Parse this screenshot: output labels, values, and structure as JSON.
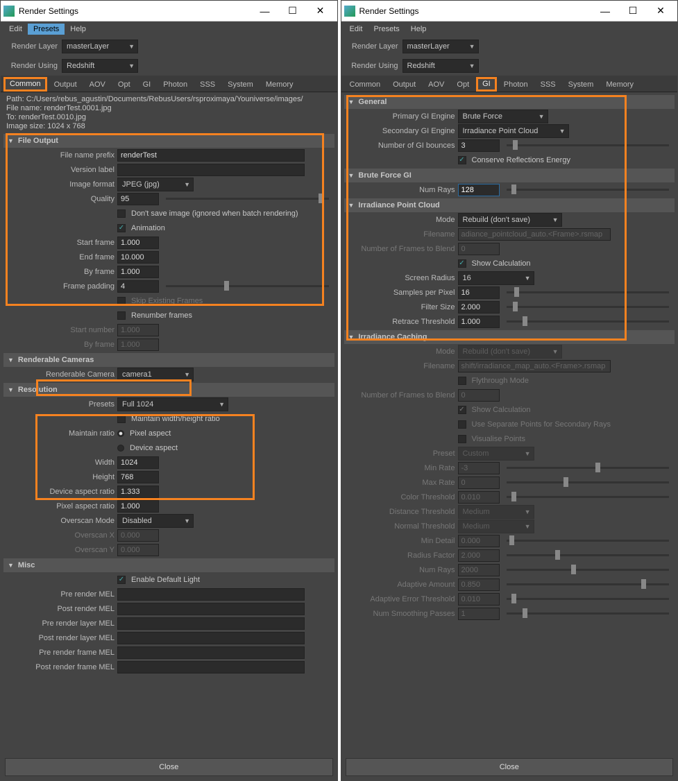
{
  "titlebar": {
    "title": "Render Settings"
  },
  "menubar": {
    "edit": "Edit",
    "presets": "Presets",
    "help": "Help"
  },
  "toprows": {
    "renderLayer": "Render Layer",
    "renderUsing": "Render Using",
    "masterLayer": "masterLayer",
    "redshift": "Redshift"
  },
  "tabs": [
    "Common",
    "Output",
    "AOV",
    "Opt",
    "GI",
    "Photon",
    "SSS",
    "System",
    "Memory"
  ],
  "path": {
    "l1": "Path: C:/Users/rebus_agustin/Documents/RebusUsers/rsproximaya/Youniverse/images/",
    "l2": "File name:  renderTest.0001.jpg",
    "l3": "To:              renderTest.0010.jpg",
    "l4": "Image size: 1024 x 768"
  },
  "s": {
    "fileOutput": "File Output",
    "renderableCameras": "Renderable Cameras",
    "resolution": "Resolution",
    "misc": "Misc",
    "general": "General",
    "bruteForce": "Brute Force GI",
    "ipc": "Irradiance Point Cloud",
    "icache": "Irradiance Caching"
  },
  "f": {
    "fnp": "File name prefix",
    "fnpv": "renderTest",
    "vl": "Version label",
    "imf": "Image format",
    "imfv": "JPEG (jpg)",
    "quality": "Quality",
    "qv": "95",
    "dsave": "Don't save image (ignored when batch rendering)",
    "anim": "Animation",
    "sf": "Start frame",
    "sfv": "1.000",
    "ef": "End frame",
    "efv": "10.000",
    "bf": "By frame",
    "bfv": "1.000",
    "fp": "Frame padding",
    "fpv": "4",
    "skip": "Skip Existing Frames",
    "renum": "Renumber frames",
    "sn": "Start number",
    "snv": "1.000",
    "bf2": "By frame",
    "bf2v": "1.000"
  },
  "cam": {
    "lbl": "Renderable Camera",
    "val": "camera1"
  },
  "res": {
    "presets": "Presets",
    "presetsv": "Full 1024",
    "mwhr": "Maintain width/height ratio",
    "mr": "Maintain ratio",
    "pa": "Pixel aspect",
    "da": "Device aspect",
    "w": "Width",
    "wv": "1024",
    "h": "Height",
    "hv": "768",
    "dar": "Device aspect ratio",
    "darv": "1.333",
    "par": "Pixel aspect ratio",
    "parv": "1.000",
    "osm": "Overscan Mode",
    "osmv": "Disabled",
    "osx": "Overscan X",
    "osxv": "0.000",
    "osy": "Overscan Y",
    "osyv": "0.000"
  },
  "misc": {
    "edl": "Enable Default Light",
    "prm": "Pre render MEL",
    "pom": "Post render MEL",
    "prlm": "Pre render layer MEL",
    "polm": "Post render layer MEL",
    "prfm": "Pre render frame MEL",
    "pofm": "Post render frame MEL"
  },
  "gi": {
    "pge": "Primary GI Engine",
    "pgev": "Brute Force",
    "sge": "Secondary GI Engine",
    "sgev": "Irradiance Point Cloud",
    "nb": "Number of GI bounces",
    "nbv": "3",
    "cre": "Conserve Reflections Energy",
    "nr": "Num Rays",
    "nrv": "128"
  },
  "ipc": {
    "mode": "Mode",
    "modev": "Rebuild (don't save)",
    "fn": "Filename",
    "fnv": "adiance_pointcloud_auto.<Frame>.rsmap",
    "nfb": "Number of Frames to Blend",
    "nfbv": "0",
    "sc": "Show Calculation",
    "sr": "Screen Radius",
    "srv": "16",
    "spp": "Samples per Pixel",
    "sppv": "16",
    "fs": "Filter Size",
    "fsv": "2.000",
    "rt": "Retrace Threshold",
    "rtv": "1.000"
  },
  "ic": {
    "mode": "Mode",
    "modev": "Rebuild (don't save)",
    "fn": "Filename",
    "fnv": "shift/irradiance_map_auto.<Frame>.rsmap",
    "ftm": "Flythrough Mode",
    "nfb": "Number of Frames to Blend",
    "nfbv": "0",
    "sc": "Show Calculation",
    "usp": "Use Separate Points for Secondary Rays",
    "vp": "Visualise Points",
    "preset": "Preset",
    "presetv": "Custom",
    "minr": "Min Rate",
    "minrv": "-3",
    "maxr": "Max Rate",
    "maxrv": "0",
    "ct": "Color Threshold",
    "ctv": "0.010",
    "dt": "Distance Threshold",
    "dtv": "Medium",
    "nt": "Normal Threshold",
    "ntv": "Medium",
    "md": "Min Detail",
    "mdv": "0.000",
    "rf": "Radius Factor",
    "rfv": "2.000",
    "nr": "Num Rays",
    "nrv": "2000",
    "aa": "Adaptive Amount",
    "aav": "0.850",
    "aet": "Adaptive Error Threshold",
    "aetv": "0.010",
    "nsp": "Num Smoothing Passes",
    "nspv": "1"
  },
  "close": "Close"
}
